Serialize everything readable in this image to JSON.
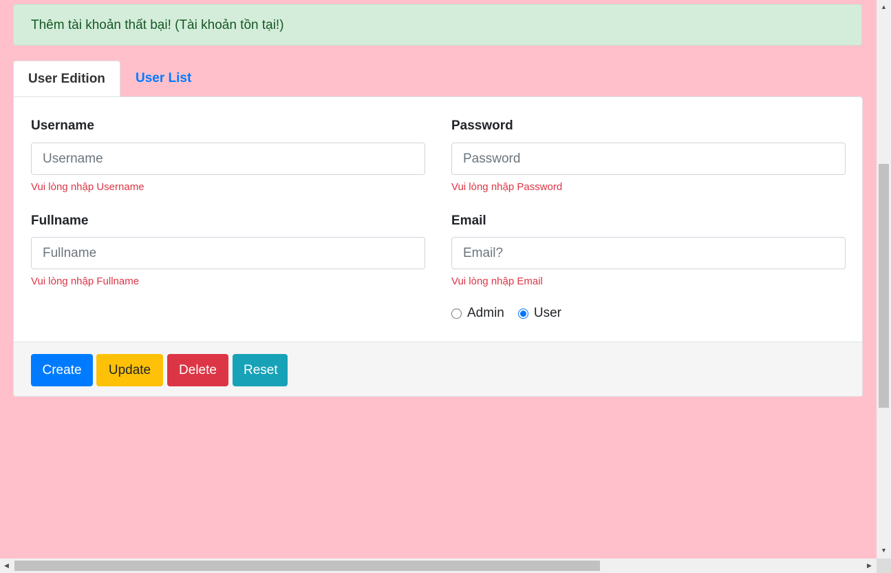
{
  "alert": {
    "message": "Thêm tài khoản thất bại! (Tài khoản tồn tại!)"
  },
  "tabs": [
    {
      "label": "User Edition",
      "active": true
    },
    {
      "label": "User List",
      "active": false
    }
  ],
  "form": {
    "username": {
      "label": "Username",
      "placeholder": "Username",
      "value": "",
      "error": "Vui lòng nhập Username"
    },
    "password": {
      "label": "Password",
      "placeholder": "Password",
      "value": "",
      "error": "Vui lòng nhập Password"
    },
    "fullname": {
      "label": "Fullname",
      "placeholder": "Fullname",
      "value": "",
      "error": "Vui lòng nhập Fullname"
    },
    "email": {
      "label": "Email",
      "placeholder": "Email?",
      "value": "",
      "error": "Vui lòng nhập Email"
    },
    "role": {
      "options": [
        {
          "label": "Admin",
          "checked": false
        },
        {
          "label": "User",
          "checked": true
        }
      ]
    }
  },
  "buttons": {
    "create": "Create",
    "update": "Update",
    "delete": "Delete",
    "reset": "Reset"
  },
  "colors": {
    "background": "#ffc0cb",
    "alert_bg": "#d4edda",
    "alert_text": "#155724",
    "primary": "#007bff",
    "warning": "#ffc107",
    "danger": "#dc3545",
    "info": "#17a2b8"
  }
}
